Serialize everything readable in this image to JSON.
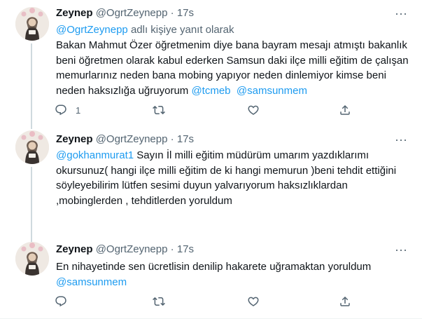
{
  "tweets": [
    {
      "name": "Zeynep",
      "handle": "@OgrtZeynepp",
      "separator": "·",
      "time": "17s",
      "reply_handle": "@OgrtZeynepp",
      "reply_suffix": " adlı kişiye yanıt olarak",
      "text": "Bakan Mahmut Özer öğretmenim diye bana bayram mesajı atmıştı bakanlık beni öğretmen olarak kabul ederken Samsun daki ilçe milli eğitim de çalışan memurlarınız neden bana mobing yapıyor neden dinlemiyor kimse beni neden haksızlığa uğruyorum ",
      "mentions_end": [
        "@tcmeb",
        "@samsunmem"
      ],
      "reply_count": "1"
    },
    {
      "name": "Zeynep",
      "handle": "@OgrtZeynepp",
      "separator": "·",
      "time": "17s",
      "mention_start": "@gokhanmurat1",
      "text": " Sayın İl milli eğitim müdürüm umarım yazdıklarımı okursunuz( hangi ilçe milli eğitim de ki hangi memurun )beni tehdit ettiğini söyleyebilirim lütfen sesimi duyun yalvarıyorum haksızlıklardan ,mobinglerden , tehditlerden yoruldum"
    },
    {
      "name": "Zeynep",
      "handle": "@OgrtZeynepp",
      "separator": "·",
      "time": "17s",
      "text": "En nihayetinde sen ücretlisin denilip hakarete uğramaktan yoruldum",
      "mention_end": "@samsunmem"
    }
  ],
  "icons": {
    "reply": "reply-icon",
    "retweet": "retweet-icon",
    "like": "like-icon",
    "share": "share-icon",
    "more": "more-icon"
  },
  "colors": {
    "link": "#1d9bf0",
    "secondary_text": "#536471",
    "thread_line": "#cfd9de"
  }
}
